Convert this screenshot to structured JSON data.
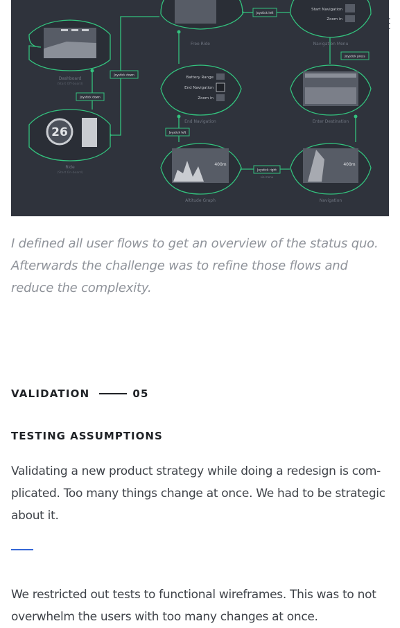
{
  "colors": {
    "accent": "#3466d6",
    "diagram_bg": "#2f333c",
    "device_outline": "#33c27e",
    "caption_gray": "#8f939a"
  },
  "nav": {
    "menu_icon": "hamburger-menu-icon"
  },
  "diagram": {
    "screens": [
      {
        "name": "Dashboard",
        "sub": "(Start Off-board)"
      },
      {
        "name": "Ride",
        "sub": "(Start On-board)",
        "value": "26"
      },
      {
        "name": "Free Ride"
      },
      {
        "name": "End Navigation",
        "menu": [
          "Battery Range",
          "End Navigation",
          "Zoom in"
        ]
      },
      {
        "name": "Altitude Graph",
        "value": "400m"
      },
      {
        "name": "Navigation Menu",
        "menu": [
          "Start Navigation",
          "Zoom in"
        ]
      },
      {
        "name": "Enter Destination"
      },
      {
        "name": "Navigation",
        "value": "400m"
      }
    ],
    "actions": [
      "Joystick left",
      "Joystick down",
      "Joystick down",
      "Joystick press",
      "Joystick left",
      "Joystick right"
    ],
    "via_menu": "via menu"
  },
  "caption": "I defined all user flows to get an overview of the status quo. Afterwards the challenge was to refine those flows and reduce the complexity.",
  "section": {
    "label": "VALIDATION",
    "number": "05"
  },
  "subheading": "TESTING ASSUMPTIONS",
  "paragraphs": [
    "Validating a new product strategy while doing a redesign is com-plicated. Too many things change at once. We had to be strategic about it.",
    "We restricted out tests to functional wireframes. This was to not overwhelm the users with too many changes at once."
  ]
}
